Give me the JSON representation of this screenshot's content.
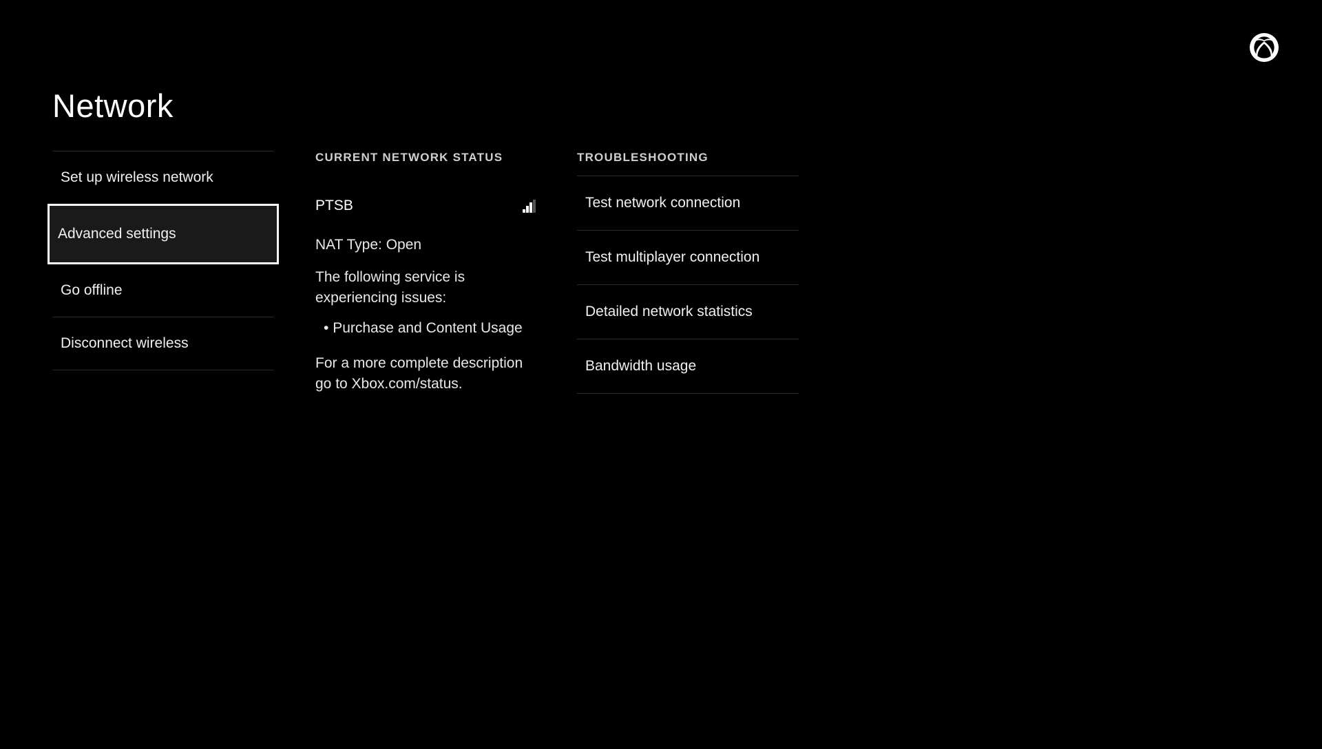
{
  "page_title": "Network",
  "left_menu": {
    "items": [
      {
        "label": "Set up wireless network",
        "selected": false
      },
      {
        "label": "Advanced settings",
        "selected": true
      },
      {
        "label": "Go offline",
        "selected": false
      },
      {
        "label": "Disconnect wireless",
        "selected": false
      }
    ]
  },
  "status": {
    "heading": "CURRENT NETWORK STATUS",
    "network_name": "PTSB",
    "signal_strength": 3,
    "nat_line": "NAT Type: Open",
    "issue_intro": "The following service is experiencing issues:",
    "issue_bullet": "Purchase and Content Usage",
    "footer_line": "For a more complete description go to Xbox.com/status."
  },
  "troubleshooting": {
    "heading": "TROUBLESHOOTING",
    "items": [
      {
        "label": "Test network connection"
      },
      {
        "label": "Test multiplayer connection"
      },
      {
        "label": "Detailed network statistics"
      },
      {
        "label": "Bandwidth usage"
      }
    ]
  }
}
